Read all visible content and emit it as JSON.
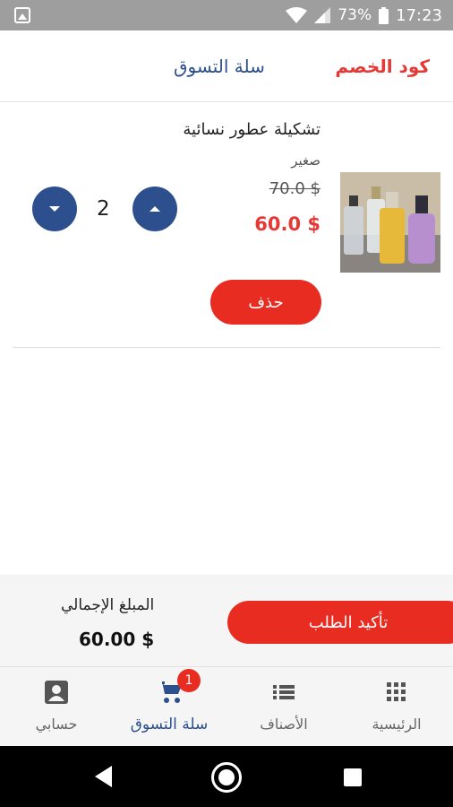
{
  "status_bar": {
    "battery": "73%",
    "time": "17:23"
  },
  "header": {
    "coupon_label": "كود الخصم",
    "title": "سلة التسوق"
  },
  "cart_item": {
    "name": "تشكيلة عطور نسائية",
    "size": "صغير",
    "old_price": "70.0 $",
    "new_price": "60.0 $",
    "quantity": "2",
    "delete_label": "حذف"
  },
  "summary": {
    "confirm_label": "تأكيد الطلب",
    "total_label": "المبلغ الإجمالي",
    "total_value": "60.00 $"
  },
  "bottom_nav": {
    "home": "الرئيسية",
    "categories": "الأصناف",
    "cart": "سلة التسوق",
    "account": "حسابي",
    "cart_badge": "1"
  },
  "colors": {
    "primary_blue": "#2d4f8e",
    "accent_red": "#e82c22"
  }
}
